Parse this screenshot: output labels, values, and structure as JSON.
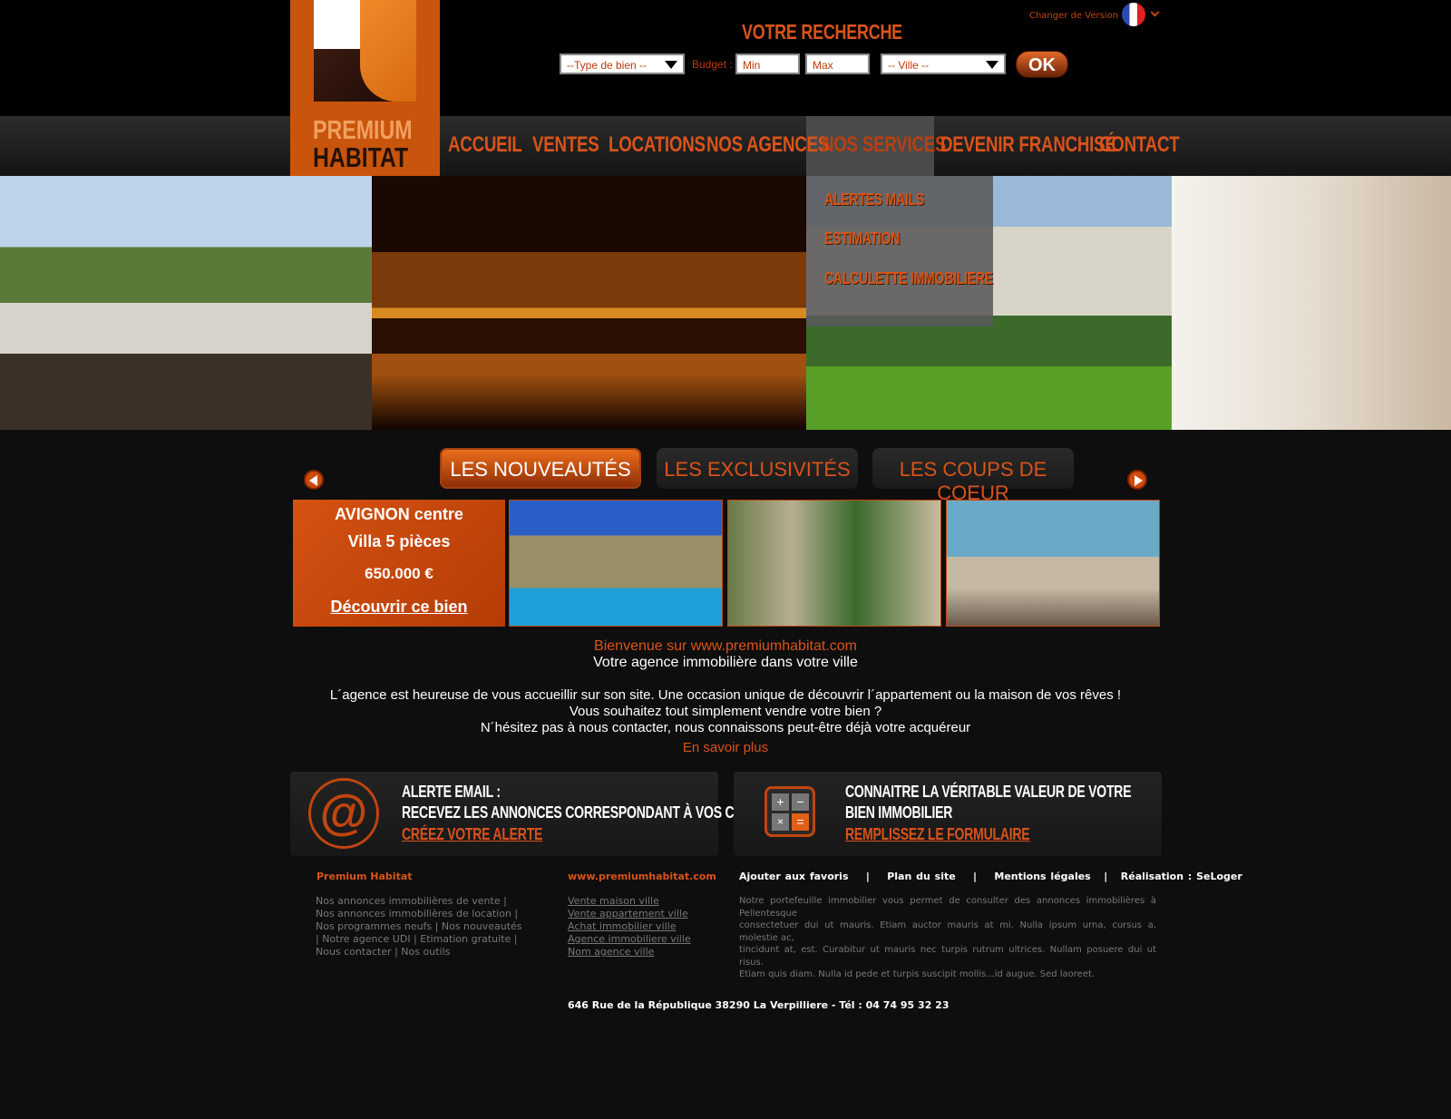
{
  "version": {
    "label": "Changer de Version",
    "flag": "flag-france-icon"
  },
  "search": {
    "title": "VOTRE RECHERCHE",
    "type_placeholder": "--Type de bien --",
    "budget_label": "Budget :",
    "min": "Min",
    "max": "Max",
    "city_placeholder": "-- Ville --",
    "ok": "OK"
  },
  "logo": {
    "line1": "PREMIUM",
    "line2": "HABITAT"
  },
  "nav": [
    "ACCUEIL",
    "VENTES",
    "LOCATIONS",
    "NOS AGENCES",
    "NOS SERVICES",
    "DEVENIR FRANCHISÉ",
    "CONTACT"
  ],
  "dropdown": [
    "ALERTES MAILS",
    "ESTIMATION",
    "CALCULETTE IMMOBILIERE"
  ],
  "tabs": [
    "LES NOUVEAUTÉS",
    "LES EXCLUSIVITÉS",
    "LES COUPS DE COEUR"
  ],
  "promo": {
    "city": "AVIGNON centre",
    "type": "Villa 5 pièces",
    "price": "650.000 €",
    "link": "Découvrir ce bien"
  },
  "welcome": {
    "title": "Bienvenue sur www.premiumhabitat.com",
    "subtitle": "Votre agence immobilière dans votre ville",
    "p1": "L´agence est heureuse de vous accueillir sur son site. Une occasion unique de découvrir l´appartement ou la maison de vos rêves !",
    "p2": "Vous souhaitez tout simplement vendre votre bien ?",
    "p3": "N´hésitez pas à nous contacter, nous connaissons peut-être déjà votre acquéreur",
    "more": "En savoir plus"
  },
  "alert_box": {
    "line1": "ALERTE EMAIL :",
    "line2": "RECEVEZ LES ANNONCES CORRESPONDANT À VOS CRITÈRES",
    "link": "CRÉEZ VOTRE ALERTE"
  },
  "value_box": {
    "line1": "CONNAITRE LA VÉRITABLE VALEUR DE VOTRE",
    "line2": "BIEN IMMOBILIER",
    "link": "REMPLISSEZ LE FORMULAIRE"
  },
  "footer": {
    "col1_title": "Premium Habitat",
    "col1_lines": [
      "Nos annonces immobilières de vente |",
      "Nos annonces immobilières de location |",
      "Nos programmes neufs | Nos nouveautés",
      "| Notre agence UDI | Etimation gratuite |",
      "Nous contacter | Nos outils"
    ],
    "col2_title": "www.premiumhabitat.com",
    "col2_links": [
      "Vente maison ville",
      "Vente appartement ville",
      "Achat immobilier ville",
      "Agence immobiliere ville",
      "Nom agence ville"
    ],
    "col3_links": [
      "Ajouter aux favoris",
      "|",
      "Plan du site",
      "|",
      "Mentions légales",
      "|",
      "Réalisation : SeLoger"
    ],
    "col3_lines": [
      "Notre portefeuille immobilier vous permet de consulter des annonces immobilières à Pellentesque",
      "consectetuer dui ut mauris. Etiam auctor mauris at mi. Nulla ipsum urna, cursus a, molestie ac,",
      "tincidunt at, est. Curabitur ut mauris nec turpis rutrum ultrices. Nullam posuere dui ut risus.",
      "Etiam quis diam. Nulla id pede et turpis suscipit mollis...id augue. Sed laoreet."
    ],
    "address": "646 Rue de la République 38290 La Verpilliere  -  Tél : 04 74 95 32 23"
  },
  "colors": {
    "accent": "#d9531a",
    "bg": "#0e0e0e"
  }
}
